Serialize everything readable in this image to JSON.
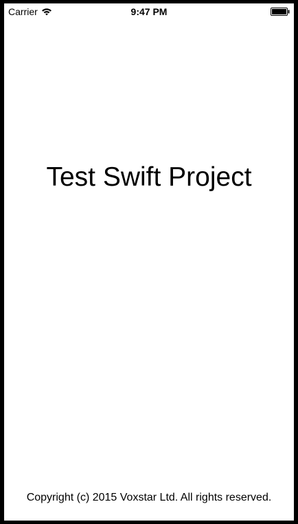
{
  "status_bar": {
    "carrier": "Carrier",
    "time": "9:47 PM",
    "wifi_icon": "wifi-icon",
    "battery_icon": "battery-icon",
    "battery_level": 1.0
  },
  "main": {
    "title": "Test Swift Project"
  },
  "footer": {
    "copyright": "Copyright (c) 2015 Voxstar Ltd. All rights reserved."
  },
  "colors": {
    "frame": "#000000",
    "background": "#ffffff",
    "text": "#000000"
  }
}
